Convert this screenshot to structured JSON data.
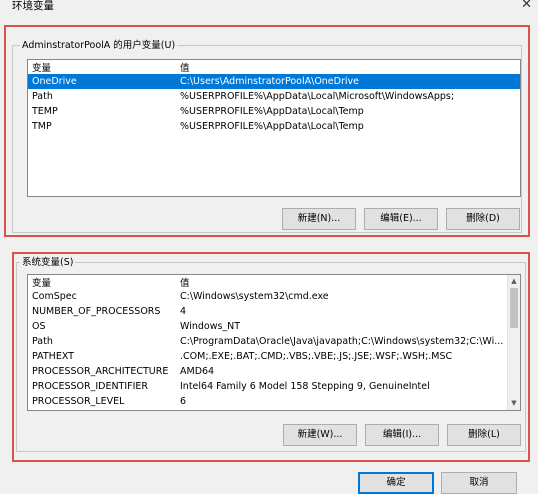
{
  "window": {
    "title": "环境变量",
    "close_glyph": "✕"
  },
  "user_vars": {
    "title": "AdminstratorPoolA 的用户变量(U)",
    "columns": [
      "变量",
      "值"
    ],
    "rows": [
      {
        "name": "OneDrive",
        "value": "C:\\Users\\AdminstratorPoolA\\OneDrive",
        "selected": true
      },
      {
        "name": "Path",
        "value": "%USERPROFILE%\\AppData\\Local\\Microsoft\\WindowsApps;"
      },
      {
        "name": "TEMP",
        "value": "%USERPROFILE%\\AppData\\Local\\Temp"
      },
      {
        "name": "TMP",
        "value": "%USERPROFILE%\\AppData\\Local\\Temp"
      }
    ],
    "buttons": {
      "new": "新建(N)...",
      "edit": "编辑(E)...",
      "delete": "删除(D)"
    }
  },
  "sys_vars": {
    "title": "系统变量(S)",
    "columns": [
      "变量",
      "值"
    ],
    "rows": [
      {
        "name": "ComSpec",
        "value": "C:\\Windows\\system32\\cmd.exe"
      },
      {
        "name": "NUMBER_OF_PROCESSORS",
        "value": "4"
      },
      {
        "name": "OS",
        "value": "Windows_NT"
      },
      {
        "name": "Path",
        "value": "C:\\ProgramData\\Oracle\\Java\\javapath;C:\\Windows\\system32;C:\\Wi..."
      },
      {
        "name": "PATHEXT",
        "value": ".COM;.EXE;.BAT;.CMD;.VBS;.VBE;.JS;.JSE;.WSF;.WSH;.MSC"
      },
      {
        "name": "PROCESSOR_ARCHITECTURE",
        "value": "AMD64"
      },
      {
        "name": "PROCESSOR_IDENTIFIER",
        "value": "Intel64 Family 6 Model 158 Stepping 9, GenuineIntel"
      },
      {
        "name": "PROCESSOR_LEVEL",
        "value": "6"
      }
    ],
    "scroll_position": 0,
    "buttons": {
      "new": "新建(W)...",
      "edit": "编辑(I)...",
      "delete": "删除(L)"
    }
  },
  "footer": {
    "ok": "确定",
    "cancel": "取消"
  },
  "colors": {
    "highlight": "#d9534f",
    "selection": "#0078d7"
  }
}
